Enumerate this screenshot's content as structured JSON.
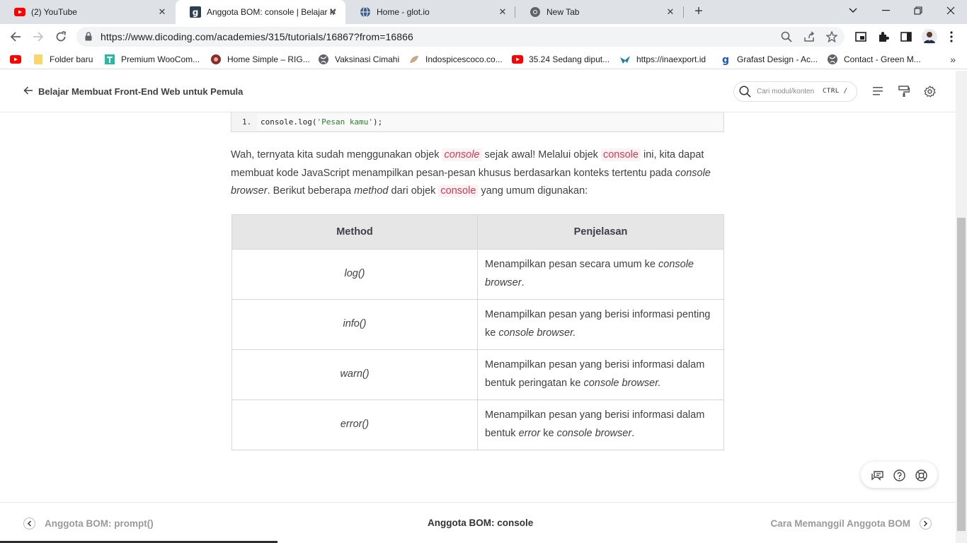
{
  "browser": {
    "tabs": [
      {
        "title": "(2) YouTube",
        "icon": "youtube-icon"
      },
      {
        "title": "Anggota BOM: console | Belajar M",
        "icon": "dicoding-icon",
        "active": true
      },
      {
        "title": "Home - glot.io",
        "icon": "glot-icon"
      },
      {
        "title": "New Tab",
        "icon": "chrome-icon"
      }
    ],
    "new_tab": "+",
    "url": "https://www.dicoding.com/academies/315/tutorials/16867?from=16866",
    "bookmarks": [
      {
        "label": "",
        "icon": "youtube-icon"
      },
      {
        "label": "Folder baru",
        "icon": "folder-icon"
      },
      {
        "label": "Premium WooCom...",
        "icon": "store-icon"
      },
      {
        "label": "Home Simple – RIG...",
        "icon": "shield-icon"
      },
      {
        "label": "Vaksinasi Cimahi",
        "icon": "globe-icon"
      },
      {
        "label": "Indospicescoco.co...",
        "icon": "leaf-icon"
      },
      {
        "label": "35.24 Sedang diput...",
        "icon": "youtube-icon"
      },
      {
        "label": "https://inaexport.id",
        "icon": "bird-icon"
      },
      {
        "label": "Grafast Design - Ac...",
        "icon": "g-icon"
      },
      {
        "label": "Contact - Green M...",
        "icon": "globe-icon"
      }
    ],
    "bookmarks_more": "»",
    "colors": {
      "tabbar": "#dee1e6",
      "omnibox": "#f1f3f4",
      "youtube": "#ff0000"
    }
  },
  "header": {
    "back_label": "Belajar Membuat Front-End Web untuk Pemula",
    "search_placeholder": "Cari modul/konten",
    "search_shortcut": "CTRL  /"
  },
  "content": {
    "code_line_number": "1.",
    "code_prefix": "console.log(",
    "code_string": "'Pesan kamu'",
    "code_suffix": ");",
    "para": {
      "t1": "Wah, ternyata kita sudah menggunakan objek ",
      "c1": "console",
      "t2": " sejak awal! Melalui objek ",
      "c2": "console",
      "t3": " ini, kita dapat membuat kode JavaScript menampilkan pesan-pesan khusus berdasarkan konteks tertentu pada ",
      "i1": "console browser",
      "t4": ". Berikut beberapa ",
      "i2": "method",
      "t5": " dari objek ",
      "c3": "console",
      "t6": " yang umum digunakan:"
    },
    "table": {
      "headers": [
        "Method",
        "Penjelasan"
      ],
      "rows": [
        {
          "method": "log()",
          "d1": "Menampilkan pesan secara umum ke ",
          "di1": "console browser",
          "d2": ".",
          "di2": "",
          "d3": ""
        },
        {
          "method": "info()",
          "d1": "Menampilkan pesan yang berisi informasi penting ke ",
          "di1": "console browser.",
          "d2": "",
          "di2": "",
          "d3": ""
        },
        {
          "method": "warn()",
          "d1": "Menampilkan pesan yang berisi informasi dalam bentuk peringatan ke ",
          "di1": "console browser.",
          "d2": "",
          "di2": "",
          "d3": ""
        },
        {
          "method": "error()",
          "d1": "Menampilkan pesan yang berisi informasi dalam bentuk ",
          "di1": "error",
          "d2": " ke ",
          "di2": "console browser",
          "d3": "."
        }
      ]
    }
  },
  "footer": {
    "prev_label": "Anggota BOM: prompt()",
    "current_label": "Anggota BOM: console",
    "next_label": "Cara Memanggil Anggota BOM"
  }
}
